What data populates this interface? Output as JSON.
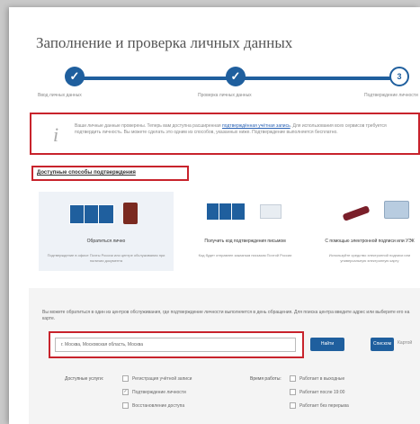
{
  "page": {
    "title": "Заполнение и проверка личных данных"
  },
  "progress": {
    "steps": [
      {
        "number": "✓",
        "label": "Ввод личных данных",
        "state": "done"
      },
      {
        "number": "✓",
        "label": "Проверка личных данных",
        "state": "done"
      },
      {
        "number": "3",
        "label": "Подтверждение личности",
        "state": "current"
      }
    ]
  },
  "info": {
    "text_1": "Ваши личные данные проверены. Теперь вам доступна расширенная ",
    "link": "подтверждённая учётная запись",
    "text_2": ". Для использования всех сервисов требуется подтвердить личность. Вы можете сделать это одним из способов, указанных ниже. Подтверждение выполняется бесплатно."
  },
  "methods": {
    "heading": "Доступные способы подтверждения",
    "cards": [
      {
        "title": "Обратиться лично",
        "desc": "Подтверждение в офисе Почты России или центре обслуживания при наличии документа"
      },
      {
        "title": "Получить код подтверждения письмом",
        "desc": "Код будет отправлен заказным письмом Почтой России"
      },
      {
        "title": "С помощью электронной подписи или УЭК",
        "desc": "Используйте средство электронной подписи или универсальную электронную карту"
      }
    ]
  },
  "search": {
    "description": "Вы можете обратиться в один из центров обслуживания, где подтверждение личности выполняется в день обращения. Для поиска центра введите адрес или выберите его на карте.",
    "value": "г. Москва, Московская область, Москва",
    "find_label": "Найти",
    "list_label": "Списком",
    "map_label": "Картой"
  },
  "filters": {
    "services_label": "Доступные услуги:",
    "services": [
      {
        "label": "Регистрация учётной записи",
        "checked": false
      },
      {
        "label": "Подтверждение личности",
        "checked": true
      },
      {
        "label": "Восстановление доступа",
        "checked": false
      }
    ],
    "schedule_label": "Время работы:",
    "schedule": [
      {
        "label": "Работает в выходные",
        "checked": false
      },
      {
        "label": "Работает после 19:00",
        "checked": false
      },
      {
        "label": "Работает без перерыва",
        "checked": false
      }
    ]
  }
}
